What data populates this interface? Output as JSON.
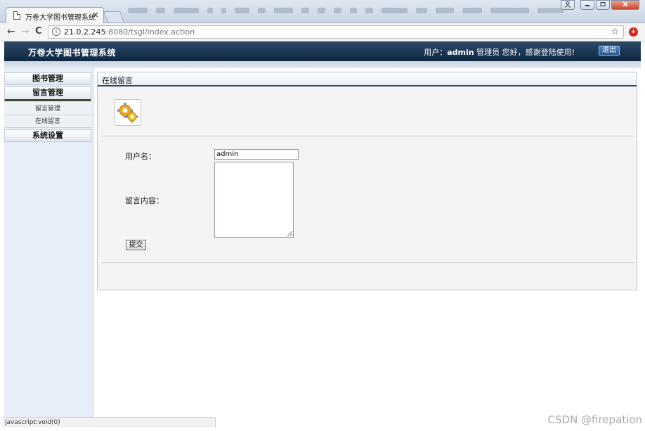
{
  "browser": {
    "tab_title": "万卷大学图书管理系统",
    "tab_close": "×",
    "url_host": "21.0.2.245",
    "url_rest": ":8080/tsgl/index.action",
    "back": "←",
    "forward": "→",
    "reload": "C",
    "star": "☆",
    "info": "i"
  },
  "header": {
    "app_title": "万卷大学图书管理系统",
    "user_prefix": "用户：",
    "user_name": "admin",
    "user_suffix": " 管理员 您好，感谢登陆使用!",
    "logout_label": "退出"
  },
  "sidebar": {
    "menus": [
      {
        "label": "图书管理"
      },
      {
        "label": "留言管理"
      },
      {
        "label": "系统设置"
      }
    ],
    "sub_items": [
      {
        "label": "留言管理"
      },
      {
        "label": "在线留言"
      }
    ]
  },
  "content": {
    "title": "在线留言",
    "username_label": "用户名：",
    "username_value": "admin",
    "message_label": "留言内容：",
    "message_value": "",
    "submit_label": "提交"
  },
  "status_bar": {
    "text": "javascript:void(0)"
  },
  "watermark": {
    "text": "CSDN @firepation"
  },
  "colors": {
    "header_bg": "#0e2640",
    "content_title_border": "#2e4766",
    "sidebar_bg": "#e7eef8",
    "logout_bg": "#2a5a93"
  }
}
